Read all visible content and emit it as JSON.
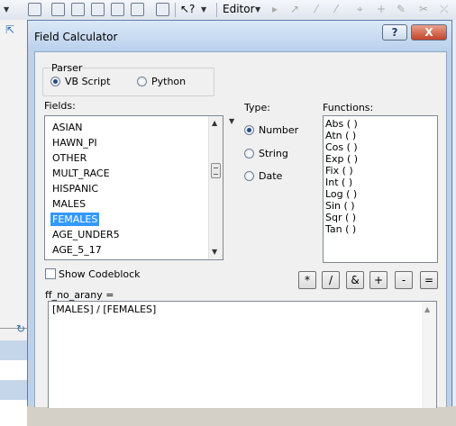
{
  "app": {
    "editor_label": "Editor",
    "editor_dropdown_icon": "triangle-down"
  },
  "dialog": {
    "title": "Field Calculator",
    "help_label": "?",
    "close_label": "X",
    "parser": {
      "label": "Parser",
      "options": [
        {
          "label": "VB Script",
          "checked": true
        },
        {
          "label": "Python",
          "checked": false
        }
      ]
    },
    "fields": {
      "label": "Fields:",
      "items": [
        "ASIAN",
        "HAWN_PI",
        "OTHER",
        "MULT_RACE",
        "HISPANIC",
        "MALES",
        "FEMALES",
        "AGE_UNDER5",
        "AGE_5_17"
      ],
      "selected": "FEMALES"
    },
    "type": {
      "label": "Type:",
      "options": [
        {
          "label": "Number",
          "checked": true
        },
        {
          "label": "String",
          "checked": false
        },
        {
          "label": "Date",
          "checked": false
        }
      ]
    },
    "functions": {
      "label": "Functions:",
      "items": [
        "Abs ( )",
        "Atn ( )",
        "Cos ( )",
        "Exp ( )",
        "Fix ( )",
        "Int ( )",
        "Log ( )",
        "Sin ( )",
        "Sqr ( )",
        "Tan ( )"
      ]
    },
    "show_codeblock": {
      "label": "Show Codeblock",
      "checked": false
    },
    "operators": [
      "*",
      "/",
      "&",
      "+",
      "-",
      "="
    ],
    "expression_label": "ff_no_arany =",
    "expression": "[MALES] / [FEMALES]"
  }
}
